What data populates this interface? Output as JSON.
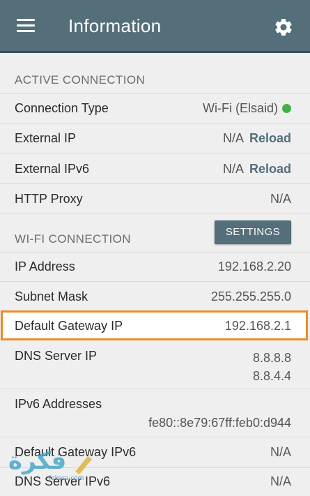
{
  "app_bar": {
    "title": "Information",
    "menu_icon": "hamburger-menu-icon",
    "settings_icon": "gear-icon",
    "color": "#546e7a"
  },
  "active_connection": {
    "title": "ACTIVE CONNECTION",
    "rows": [
      {
        "label": "Connection Type",
        "value": "Wi-Fi (Elsaid)",
        "status_color": "#43b047"
      },
      {
        "label": "External IP",
        "value": "N/A",
        "action": "Reload"
      },
      {
        "label": "External IPv6",
        "value": "N/A",
        "action": "Reload"
      },
      {
        "label": "HTTP Proxy",
        "value": "N/A"
      }
    ]
  },
  "wifi_connection": {
    "title": "WI-FI CONNECTION",
    "settings_button": "SETTINGS",
    "rows": [
      {
        "label": "IP Address",
        "value": "192.168.2.20"
      },
      {
        "label": "Subnet Mask",
        "value": "255.255.255.0"
      },
      {
        "label": "Default Gateway IP",
        "value": "192.168.2.1",
        "highlight_color": "#f08a24"
      },
      {
        "label": "DNS Server IP",
        "values": [
          "8.8.8.8",
          "8.8.4.4"
        ]
      },
      {
        "label": "IPv6 Addresses",
        "value": "fe80::8e79:67ff:feb0:d944"
      },
      {
        "label": "Default Gateway IPv6",
        "value": "N/A"
      },
      {
        "label": "DNS Server IPv6",
        "value": "N/A"
      }
    ]
  },
  "watermark": {
    "text": "فكرة",
    "subtext": "fekera.com"
  }
}
